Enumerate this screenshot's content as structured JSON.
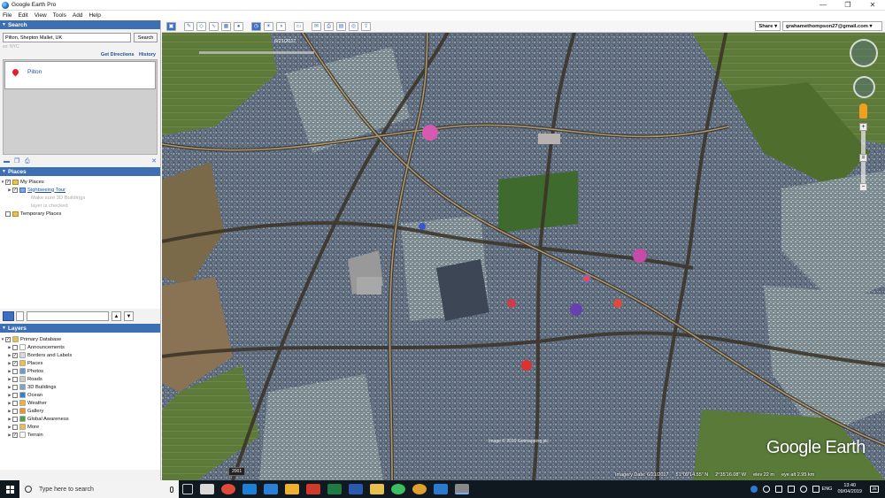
{
  "window": {
    "title": "Google Earth Pro",
    "controls": {
      "minimize": "—",
      "maximize": "❐",
      "close": "✕"
    }
  },
  "menu": [
    "File",
    "Edit",
    "View",
    "Tools",
    "Add",
    "Help"
  ],
  "search": {
    "header": "Search",
    "query": "Pilton, Shepton Mallet, UK",
    "button": "Search",
    "hint": "ex: NYC",
    "get_directions": "Get Directions",
    "history": "History",
    "result": "Pilton"
  },
  "places": {
    "header": "Places",
    "my_places": "My Places",
    "sightseeing": "Sightseeing Tour",
    "sightseeing_note1": "Make sure 3D Buildings",
    "sightseeing_note2": "layer is checked",
    "temporary": "Temporary Places"
  },
  "layers": {
    "header": "Layers",
    "items": [
      {
        "label": "Primary Database",
        "checked": true,
        "color": "#e8c14a"
      },
      {
        "label": "Announcements",
        "checked": false,
        "color": "#ffffff"
      },
      {
        "label": "Borders and Labels",
        "checked": true,
        "color": "#d9d9d9"
      },
      {
        "label": "Places",
        "checked": true,
        "color": "#f0c040"
      },
      {
        "label": "Photos",
        "checked": false,
        "color": "#6a9ad8"
      },
      {
        "label": "Roads",
        "checked": false,
        "color": "#cccccc"
      },
      {
        "label": "3D Buildings",
        "checked": false,
        "color": "#7fa3c8"
      },
      {
        "label": "Ocean",
        "checked": false,
        "color": "#2f7fd6"
      },
      {
        "label": "Weather",
        "checked": false,
        "color": "#f4b030"
      },
      {
        "label": "Gallery",
        "checked": false,
        "color": "#e39a2a"
      },
      {
        "label": "Global Awareness",
        "checked": false,
        "color": "#4aa14a"
      },
      {
        "label": "More",
        "checked": false,
        "color": "#e8c14a"
      },
      {
        "label": "Terrain",
        "checked": true,
        "color": "#ffffff"
      }
    ]
  },
  "toolbar": {
    "share": "Share ▾",
    "account": "grahamethompson27@gmail.com ▾"
  },
  "map": {
    "date": "6/21/2017",
    "year_badge": "2001",
    "logo": "Google Earth",
    "credit": "Image © 2019 Getmapping plc",
    "status": {
      "imagery": "Imagery Date: 6/21/2017",
      "lat": "51°09'14.55\" N",
      "lon": "2°35'16.08\" W",
      "elev": "elev   22 m",
      "eye": "eye alt   2.95 km"
    }
  },
  "taskbar": {
    "search_placeholder": "Type here to search",
    "lang": "ENG",
    "time": "13:40",
    "date": "09/04/2019",
    "notif": "25"
  }
}
